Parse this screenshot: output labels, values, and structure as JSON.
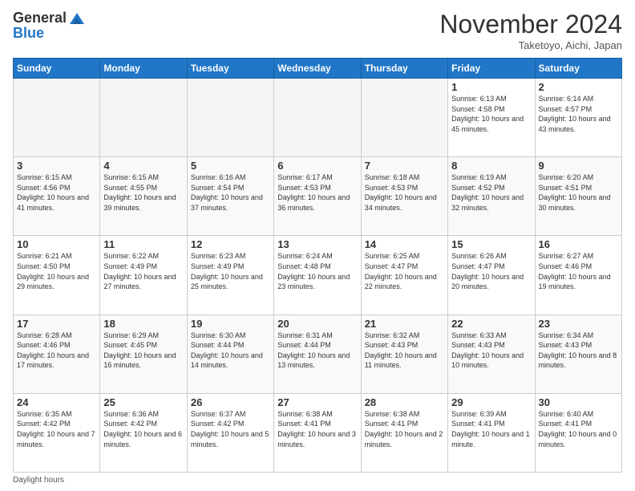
{
  "header": {
    "logo_general": "General",
    "logo_blue": "Blue",
    "month_title": "November 2024",
    "location": "Taketoyo, Aichi, Japan"
  },
  "footer": {
    "daylight_label": "Daylight hours"
  },
  "days_of_week": [
    "Sunday",
    "Monday",
    "Tuesday",
    "Wednesday",
    "Thursday",
    "Friday",
    "Saturday"
  ],
  "weeks": [
    [
      {
        "day": "",
        "info": ""
      },
      {
        "day": "",
        "info": ""
      },
      {
        "day": "",
        "info": ""
      },
      {
        "day": "",
        "info": ""
      },
      {
        "day": "",
        "info": ""
      },
      {
        "day": "1",
        "info": "Sunrise: 6:13 AM\nSunset: 4:58 PM\nDaylight: 10 hours\nand 45 minutes."
      },
      {
        "day": "2",
        "info": "Sunrise: 6:14 AM\nSunset: 4:57 PM\nDaylight: 10 hours\nand 43 minutes."
      }
    ],
    [
      {
        "day": "3",
        "info": "Sunrise: 6:15 AM\nSunset: 4:56 PM\nDaylight: 10 hours\nand 41 minutes."
      },
      {
        "day": "4",
        "info": "Sunrise: 6:15 AM\nSunset: 4:55 PM\nDaylight: 10 hours\nand 39 minutes."
      },
      {
        "day": "5",
        "info": "Sunrise: 6:16 AM\nSunset: 4:54 PM\nDaylight: 10 hours\nand 37 minutes."
      },
      {
        "day": "6",
        "info": "Sunrise: 6:17 AM\nSunset: 4:53 PM\nDaylight: 10 hours\nand 36 minutes."
      },
      {
        "day": "7",
        "info": "Sunrise: 6:18 AM\nSunset: 4:53 PM\nDaylight: 10 hours\nand 34 minutes."
      },
      {
        "day": "8",
        "info": "Sunrise: 6:19 AM\nSunset: 4:52 PM\nDaylight: 10 hours\nand 32 minutes."
      },
      {
        "day": "9",
        "info": "Sunrise: 6:20 AM\nSunset: 4:51 PM\nDaylight: 10 hours\nand 30 minutes."
      }
    ],
    [
      {
        "day": "10",
        "info": "Sunrise: 6:21 AM\nSunset: 4:50 PM\nDaylight: 10 hours\nand 29 minutes."
      },
      {
        "day": "11",
        "info": "Sunrise: 6:22 AM\nSunset: 4:49 PM\nDaylight: 10 hours\nand 27 minutes."
      },
      {
        "day": "12",
        "info": "Sunrise: 6:23 AM\nSunset: 4:49 PM\nDaylight: 10 hours\nand 25 minutes."
      },
      {
        "day": "13",
        "info": "Sunrise: 6:24 AM\nSunset: 4:48 PM\nDaylight: 10 hours\nand 23 minutes."
      },
      {
        "day": "14",
        "info": "Sunrise: 6:25 AM\nSunset: 4:47 PM\nDaylight: 10 hours\nand 22 minutes."
      },
      {
        "day": "15",
        "info": "Sunrise: 6:26 AM\nSunset: 4:47 PM\nDaylight: 10 hours\nand 20 minutes."
      },
      {
        "day": "16",
        "info": "Sunrise: 6:27 AM\nSunset: 4:46 PM\nDaylight: 10 hours\nand 19 minutes."
      }
    ],
    [
      {
        "day": "17",
        "info": "Sunrise: 6:28 AM\nSunset: 4:46 PM\nDaylight: 10 hours\nand 17 minutes."
      },
      {
        "day": "18",
        "info": "Sunrise: 6:29 AM\nSunset: 4:45 PM\nDaylight: 10 hours\nand 16 minutes."
      },
      {
        "day": "19",
        "info": "Sunrise: 6:30 AM\nSunset: 4:44 PM\nDaylight: 10 hours\nand 14 minutes."
      },
      {
        "day": "20",
        "info": "Sunrise: 6:31 AM\nSunset: 4:44 PM\nDaylight: 10 hours\nand 13 minutes."
      },
      {
        "day": "21",
        "info": "Sunrise: 6:32 AM\nSunset: 4:43 PM\nDaylight: 10 hours\nand 11 minutes."
      },
      {
        "day": "22",
        "info": "Sunrise: 6:33 AM\nSunset: 4:43 PM\nDaylight: 10 hours\nand 10 minutes."
      },
      {
        "day": "23",
        "info": "Sunrise: 6:34 AM\nSunset: 4:43 PM\nDaylight: 10 hours\nand 8 minutes."
      }
    ],
    [
      {
        "day": "24",
        "info": "Sunrise: 6:35 AM\nSunset: 4:42 PM\nDaylight: 10 hours\nand 7 minutes."
      },
      {
        "day": "25",
        "info": "Sunrise: 6:36 AM\nSunset: 4:42 PM\nDaylight: 10 hours\nand 6 minutes."
      },
      {
        "day": "26",
        "info": "Sunrise: 6:37 AM\nSunset: 4:42 PM\nDaylight: 10 hours\nand 5 minutes."
      },
      {
        "day": "27",
        "info": "Sunrise: 6:38 AM\nSunset: 4:41 PM\nDaylight: 10 hours\nand 3 minutes."
      },
      {
        "day": "28",
        "info": "Sunrise: 6:38 AM\nSunset: 4:41 PM\nDaylight: 10 hours\nand 2 minutes."
      },
      {
        "day": "29",
        "info": "Sunrise: 6:39 AM\nSunset: 4:41 PM\nDaylight: 10 hours\nand 1 minute."
      },
      {
        "day": "30",
        "info": "Sunrise: 6:40 AM\nSunset: 4:41 PM\nDaylight: 10 hours\nand 0 minutes."
      }
    ]
  ]
}
